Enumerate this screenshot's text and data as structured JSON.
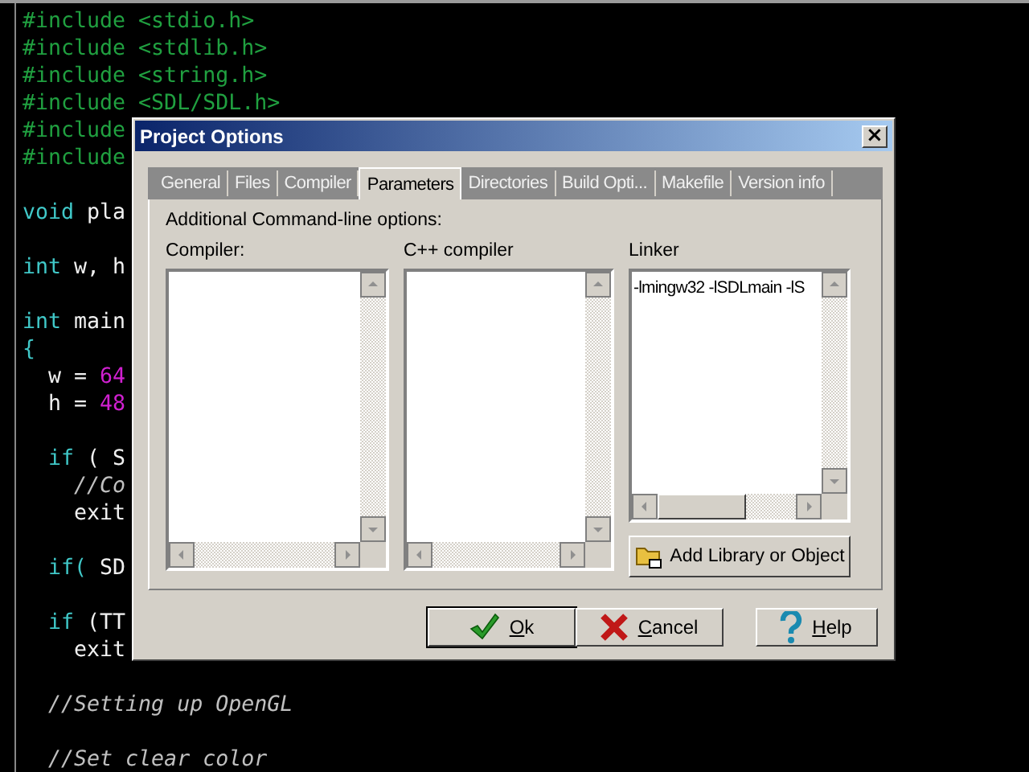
{
  "editor": {
    "blocks": [
      {
        "lines": [
          {
            "segments": [
              {
                "kind": "preproc",
                "text": "#include <stdio.h>"
              }
            ]
          },
          {
            "segments": [
              {
                "kind": "preproc",
                "text": "#include <stdlib.h>"
              }
            ]
          },
          {
            "segments": [
              {
                "kind": "preproc",
                "text": "#include <string.h>"
              }
            ]
          },
          {
            "segments": [
              {
                "kind": "preproc",
                "text": "#include <SDL/SDL.h>"
              }
            ]
          },
          {
            "segments": [
              {
                "kind": "preproc",
                "text": "#include"
              }
            ]
          },
          {
            "segments": [
              {
                "kind": "preproc",
                "text": "#include"
              }
            ]
          }
        ]
      },
      {
        "lines": [
          {
            "segments": [
              {
                "kind": "keyword",
                "text": "void"
              },
              {
                "kind": "plain",
                "text": " pla"
              }
            ]
          }
        ]
      },
      {
        "lines": [
          {
            "segments": [
              {
                "kind": "keyword",
                "text": "int"
              },
              {
                "kind": "plain",
                "text": " w, h"
              }
            ]
          }
        ]
      },
      {
        "lines": [
          {
            "segments": [
              {
                "kind": "keyword",
                "text": "int"
              },
              {
                "kind": "plain",
                "text": " main"
              }
            ]
          },
          {
            "segments": [
              {
                "kind": "keyword",
                "text": "{"
              }
            ]
          },
          {
            "segments": [
              {
                "kind": "plain",
                "text": "  w = "
              },
              {
                "kind": "number",
                "text": "64"
              }
            ]
          },
          {
            "segments": [
              {
                "kind": "plain",
                "text": "  h = "
              },
              {
                "kind": "number",
                "text": "48"
              }
            ]
          }
        ]
      },
      {
        "lines": [
          {
            "segments": [
              {
                "kind": "keyword",
                "text": "  if"
              },
              {
                "kind": "plain",
                "text": " ( S"
              }
            ]
          },
          {
            "segments": [
              {
                "kind": "comment",
                "text": "    //Co"
              }
            ]
          },
          {
            "segments": [
              {
                "kind": "plain",
                "text": "    exit"
              }
            ]
          }
        ]
      },
      {
        "lines": [
          {
            "segments": [
              {
                "kind": "keyword",
                "text": "  if("
              },
              {
                "kind": "plain",
                "text": " SD"
              }
            ]
          }
        ]
      },
      {
        "lines": [
          {
            "segments": [
              {
                "kind": "keyword",
                "text": "  if"
              },
              {
                "kind": "plain",
                "text": " (TT"
              }
            ]
          },
          {
            "segments": [
              {
                "kind": "plain",
                "text": "    exit"
              }
            ]
          }
        ]
      },
      {
        "lines": [
          {
            "segments": [
              {
                "kind": "comment",
                "text": "  //Setting up OpenGL"
              }
            ]
          }
        ]
      },
      {
        "lines": [
          {
            "segments": [
              {
                "kind": "comment",
                "text": "  //Set clear color"
              }
            ]
          }
        ]
      }
    ]
  },
  "dialog": {
    "title": "Project Options",
    "close": "×",
    "tabs": [
      {
        "label": "General",
        "selected": false
      },
      {
        "label": "Files",
        "selected": false
      },
      {
        "label": "Compiler",
        "selected": false
      },
      {
        "label": "Parameters",
        "selected": true
      },
      {
        "label": "Directories",
        "selected": false
      },
      {
        "label": "Build Opti...",
        "selected": false
      },
      {
        "label": "Makefile",
        "selected": false
      },
      {
        "label": "Version info",
        "selected": false
      }
    ],
    "section_label": "Additional Command-line options:",
    "lists": [
      {
        "label": "Compiler:"
      },
      {
        "label": "C++ compiler"
      },
      {
        "label": "Linker",
        "lines": [
          "-lmingw32 -lSDLmain -lS"
        ]
      }
    ],
    "add_button": "Add Library or Object",
    "buttons": [
      {
        "label": "Ok",
        "kind": "ok",
        "default": true
      },
      {
        "label": "Cancel",
        "kind": "cancel",
        "default": false
      },
      {
        "label": "Help",
        "kind": "help",
        "default": false
      }
    ]
  }
}
